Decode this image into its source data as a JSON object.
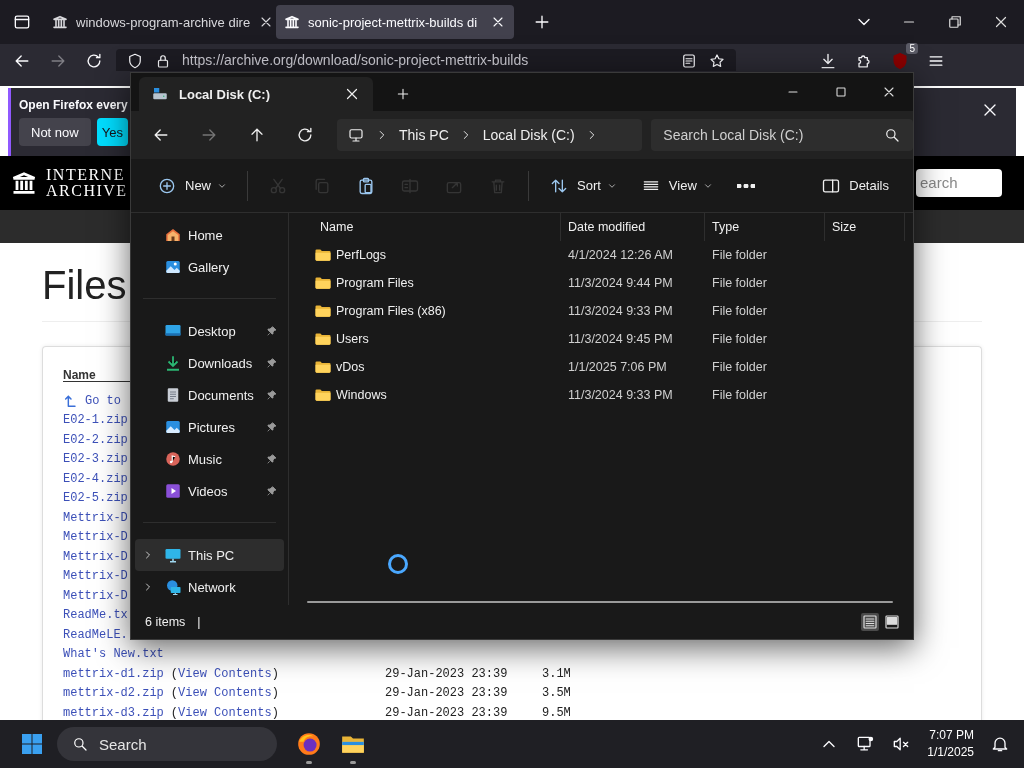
{
  "browser": {
    "tabs": [
      {
        "title": "windows-program-archive dire",
        "selected": false
      },
      {
        "title": "sonic-project-mettrix-builds di",
        "selected": true
      }
    ],
    "nav": [
      {
        "kind": "back",
        "disabled": false
      },
      {
        "kind": "forward",
        "disabled": true
      },
      {
        "kind": "reload",
        "disabled": false
      }
    ],
    "url": "https://archive.org/download/sonic-project-mettrix-builds",
    "extension_badge": "5",
    "notification": {
      "message": "Open Firefox every",
      "buttons": [
        {
          "label": "Not now",
          "kind": "secondary"
        },
        {
          "label": "Yes",
          "kind": "primary"
        }
      ]
    },
    "site": {
      "logo_lines": [
        "INTERNE",
        "ARCHIVE"
      ],
      "search_placeholder": "earch",
      "heading": "Files",
      "table": {
        "column_1": "Name",
        "partial_rows": [
          {
            "kind": "parent",
            "name": "Go to"
          },
          {
            "kind": "file",
            "name": "E02-1.zip"
          },
          {
            "kind": "file",
            "name": "E02-2.zip"
          },
          {
            "kind": "file",
            "name": "E02-3.zip"
          },
          {
            "kind": "file",
            "name": "E02-4.zip"
          },
          {
            "kind": "file",
            "name": "E02-5.zip"
          },
          {
            "kind": "file",
            "name": "Mettrix-D"
          },
          {
            "kind": "file",
            "name": "Mettrix-D"
          },
          {
            "kind": "file",
            "name": "Mettrix-D"
          },
          {
            "kind": "file",
            "name": "Mettrix-D"
          },
          {
            "kind": "file",
            "name": "Mettrix-D"
          },
          {
            "kind": "file",
            "name": "ReadMe.tx"
          },
          {
            "kind": "file",
            "name": "ReadMeLE."
          }
        ],
        "rows": [
          {
            "name": "What's New.txt"
          },
          {
            "name": "mettrix-d1.zip",
            "before": "(",
            "link": "View Contents",
            "after": ")",
            "date": "29-Jan-2023 23:39",
            "size": "3.1M"
          },
          {
            "name": "mettrix-d2.zip",
            "before": "(",
            "link": "View Contents",
            "after": ")",
            "date": "29-Jan-2023 23:39",
            "size": "3.5M"
          },
          {
            "name": "mettrix-d3.zip",
            "before": "(",
            "link": "View Contents",
            "after": ")",
            "date": "29-Jan-2023 23:39",
            "size": "9.5M"
          }
        ]
      }
    }
  },
  "explorer": {
    "tab_title": "Local Disk (C:)",
    "nav": [
      {
        "kind": "back",
        "disabled": false
      },
      {
        "kind": "forward",
        "disabled": true
      },
      {
        "kind": "up",
        "disabled": false
      },
      {
        "kind": "refresh",
        "disabled": false
      }
    ],
    "breadcrumb": [
      "This PC",
      "Local Disk (C:)"
    ],
    "search_placeholder": "Search Local Disk (C:)",
    "toolbar": [
      [
        {
          "kind": "new",
          "label": "New",
          "dropdown": true,
          "disabled": false
        }
      ],
      [
        {
          "kind": "cut",
          "dropdown": false,
          "disabled": true
        },
        {
          "kind": "copy",
          "dropdown": false,
          "disabled": true
        },
        {
          "kind": "paste",
          "dropdown": false,
          "disabled": false
        },
        {
          "kind": "rename",
          "dropdown": false,
          "disabled": true
        },
        {
          "kind": "share",
          "dropdown": false,
          "disabled": true
        },
        {
          "kind": "delete",
          "dropdown": false,
          "disabled": true
        }
      ],
      [
        {
          "kind": "sort",
          "label": "Sort",
          "dropdown": true,
          "disabled": false
        },
        {
          "kind": "view",
          "label": "View",
          "dropdown": true,
          "disabled": false
        },
        {
          "kind": "more",
          "dropdown": false,
          "disabled": false
        }
      ]
    ],
    "details_label": "Details",
    "sidebar": [
      {
        "items": [
          {
            "kind": "home",
            "label": "Home",
            "selected": false
          },
          {
            "kind": "gallery",
            "label": "Gallery",
            "selected": false
          }
        ]
      },
      {
        "items": [
          {
            "kind": "desktop",
            "label": "Desktop",
            "pinned": true,
            "selected": false
          },
          {
            "kind": "downloads",
            "label": "Downloads",
            "pinned": true,
            "selected": false
          },
          {
            "kind": "documents",
            "label": "Documents",
            "pinned": true,
            "selected": false
          },
          {
            "kind": "pictures",
            "label": "Pictures",
            "pinned": true,
            "selected": false
          },
          {
            "kind": "music",
            "label": "Music",
            "pinned": true,
            "selected": false
          },
          {
            "kind": "videos",
            "label": "Videos",
            "pinned": true,
            "selected": false
          }
        ]
      },
      {
        "items": [
          {
            "kind": "pc",
            "label": "This PC",
            "expanded": false,
            "selected": true
          },
          {
            "kind": "network",
            "label": "Network",
            "expanded": false,
            "selected": false
          }
        ]
      }
    ],
    "columns": [
      "Name",
      "Date modified",
      "Type",
      "Size"
    ],
    "files": [
      {
        "name": "PerfLogs",
        "date": "4/1/2024 12:26 AM",
        "type": "File folder"
      },
      {
        "name": "Program Files",
        "date": "11/3/2024 9:44 PM",
        "type": "File folder"
      },
      {
        "name": "Program Files (x86)",
        "date": "11/3/2024 9:33 PM",
        "type": "File folder"
      },
      {
        "name": "Users",
        "date": "11/3/2024 9:45 PM",
        "type": "File folder"
      },
      {
        "name": "vDos",
        "date": "1/1/2025 7:06 PM",
        "type": "File folder"
      },
      {
        "name": "Windows",
        "date": "11/3/2024 9:33 PM",
        "type": "File folder"
      }
    ],
    "loading": true,
    "status": "6 items",
    "status_separator": "|",
    "view_buttons": [
      {
        "kind": "details",
        "selected": true
      },
      {
        "kind": "tiles",
        "selected": false
      }
    ]
  },
  "taskbar": {
    "search_placeholder": "Search",
    "apps": [
      {
        "kind": "firefox",
        "running": true
      },
      {
        "kind": "explorer",
        "running": true
      }
    ],
    "time": "7:07 PM",
    "date": "1/1/2025"
  }
}
